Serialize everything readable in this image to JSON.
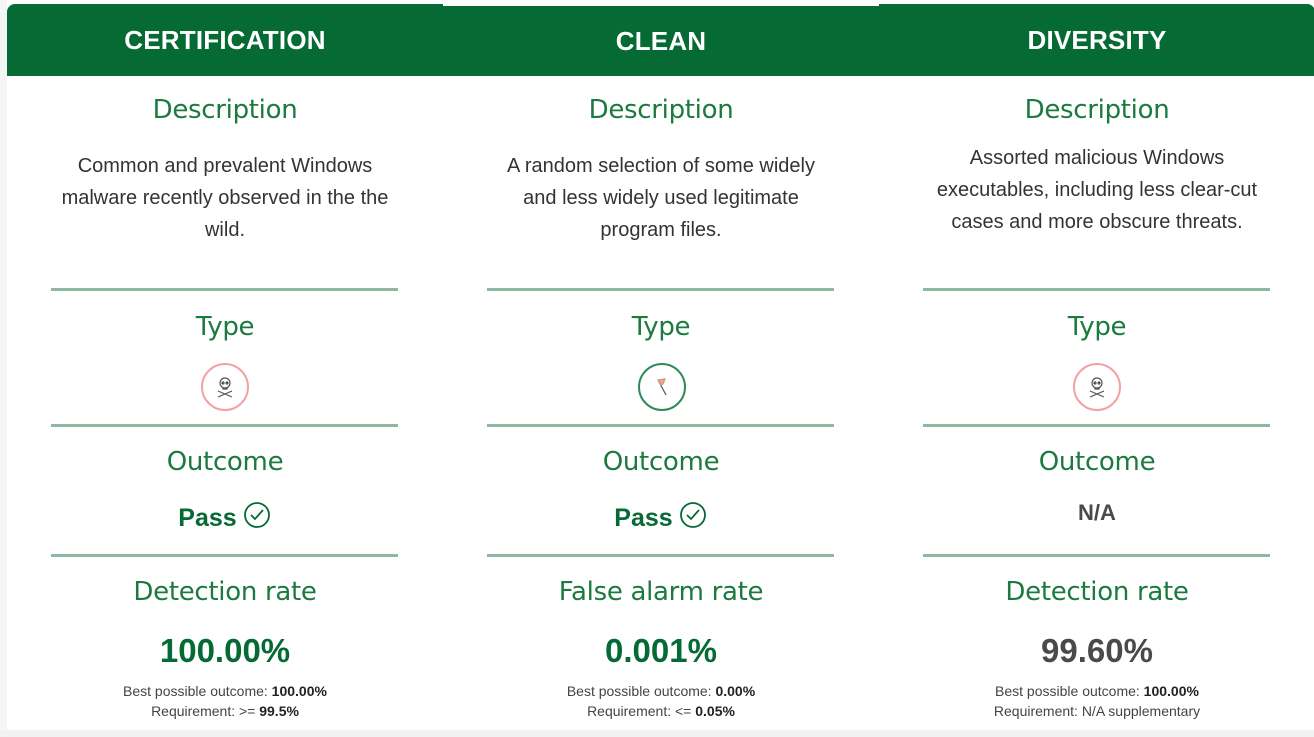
{
  "colors": {
    "header_bg": "#066a34",
    "accent": "#1d7a3f",
    "rule": "#8fb8a0",
    "malware_icon": "#f2a1a5",
    "clean_icon": "#2e8b57"
  },
  "columns": [
    {
      "header": "CERTIFICATION",
      "description_title": "Description",
      "description": "Common and prevalent Windows malware recently observed in the the wild.",
      "type_title": "Type",
      "type_icon": "skull-crossbones-icon",
      "outcome_title": "Outcome",
      "outcome": "Pass",
      "outcome_icon": "check-circle-icon",
      "rate_title": "Detection rate",
      "rate_value": "100.00%",
      "best_label": "Best possible outcome: ",
      "best_value": "100.00%",
      "req_label": "Requirement: >= ",
      "req_value": "99.5%"
    },
    {
      "header": "CLEAN",
      "description_title": "Description",
      "description": "A random selection of some widely and less widely used legitimate program files.",
      "type_title": "Type",
      "type_icon": "flag-icon",
      "outcome_title": "Outcome",
      "outcome": "Pass",
      "outcome_icon": "check-circle-icon",
      "rate_title": "False alarm rate",
      "rate_value": "0.001%",
      "best_label": "Best possible outcome: ",
      "best_value": "0.00%",
      "req_label": "Requirement: <= ",
      "req_value": "0.05%"
    },
    {
      "header": "DIVERSITY",
      "description_title": "Description",
      "description": "Assorted malicious Windows executables, including less clear-cut cases and more obscure threats.",
      "type_title": "Type",
      "type_icon": "skull-crossbones-icon",
      "outcome_title": "Outcome",
      "outcome": "N/A",
      "rate_title": "Detection rate",
      "rate_value": "99.60%",
      "best_label": "Best possible outcome: ",
      "best_value": "100.00%",
      "req_label": "Requirement: N/A supplementary",
      "req_value": ""
    }
  ]
}
